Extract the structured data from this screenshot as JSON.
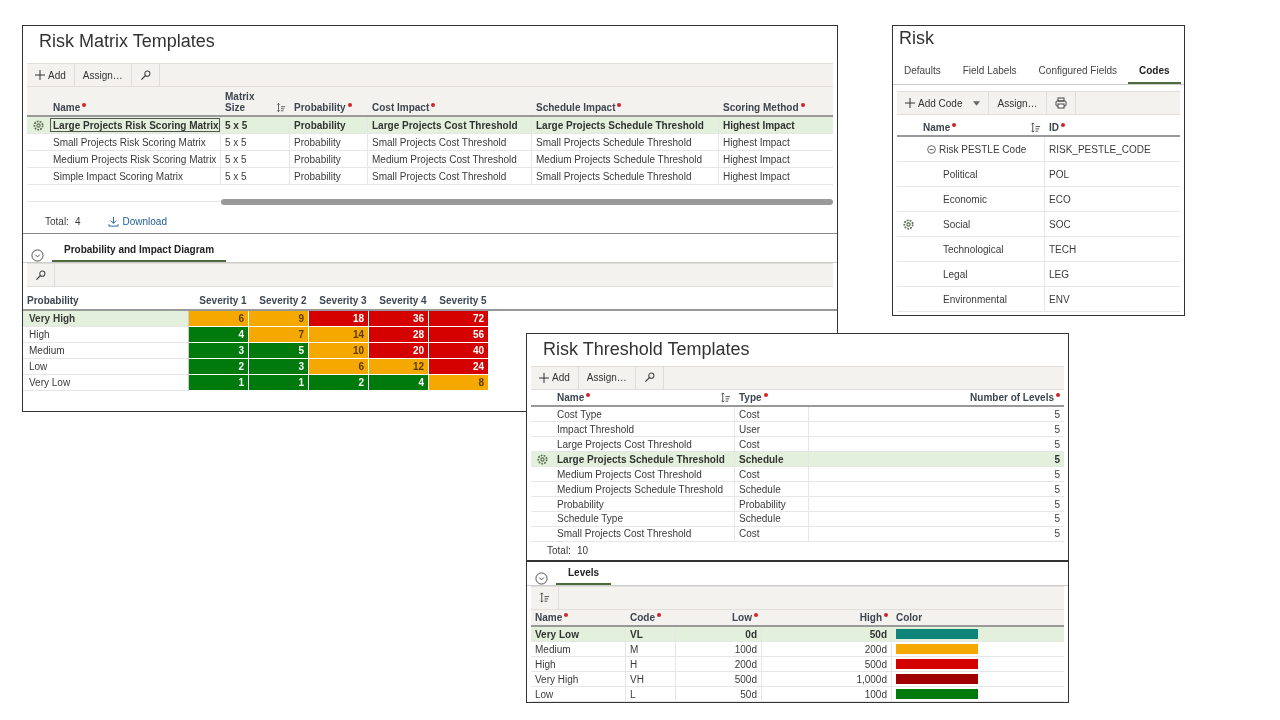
{
  "matrix_templates": {
    "title": "Risk Matrix Templates",
    "toolbar": [
      {
        "kind": "add",
        "label": "Add"
      },
      {
        "kind": "text",
        "label": "Assign…"
      },
      {
        "kind": "tool"
      }
    ],
    "columns": [
      {
        "label": "Name",
        "required": true,
        "sorted": false
      },
      {
        "label": "Matrix Size",
        "required": false,
        "sorted": true
      },
      {
        "label": "Probability",
        "required": true,
        "sorted": false
      },
      {
        "label": "Cost Impact",
        "required": true,
        "sorted": false
      },
      {
        "label": "Schedule Impact",
        "required": true,
        "sorted": false
      },
      {
        "label": "Scoring Method",
        "required": true,
        "sorted": false
      }
    ],
    "rows": [
      {
        "selected": true,
        "cells": [
          "Large Projects Risk Scoring Matrix",
          "5 x 5",
          "Probability",
          "Large Projects Cost Threshold",
          "Large Projects Schedule Threshold",
          "Highest Impact"
        ]
      },
      {
        "selected": false,
        "cells": [
          "Small Projects Risk Scoring Matrix",
          "5 x 5",
          "Probability",
          "Small Projects Cost Threshold",
          "Small Projects Schedule Threshold",
          "Highest Impact"
        ]
      },
      {
        "selected": false,
        "cells": [
          "Medium Projects Risk Scoring Matrix",
          "5 x 5",
          "Probability",
          "Medium Projects Cost Threshold",
          "Medium Projects Schedule Threshold",
          "Highest Impact"
        ]
      },
      {
        "selected": false,
        "cells": [
          "Simple Impact Scoring Matrix",
          "5 x 5",
          "Probability",
          "Small Projects Cost Threshold",
          "Small Projects Schedule Threshold",
          "Highest Impact"
        ]
      }
    ],
    "total_label": "Total:",
    "total": "4",
    "download": "Download",
    "diagram": {
      "tab": "Probability and Impact Diagram",
      "toolbar": [
        {
          "kind": "tool"
        }
      ],
      "row_header_column": "Probability",
      "columns": [
        "Severity 1",
        "Severity 2",
        "Severity 3",
        "Severity 4",
        "Severity 5"
      ],
      "rows": [
        {
          "label": "Very High",
          "selected": true,
          "cells": [
            {
              "value": "6",
              "color": "#f5a800"
            },
            {
              "value": "9",
              "color": "#f5a800"
            },
            {
              "value": "18",
              "color": "#d50000"
            },
            {
              "value": "36",
              "color": "#d50000"
            },
            {
              "value": "72",
              "color": "#d50000"
            }
          ]
        },
        {
          "label": "High",
          "selected": false,
          "cells": [
            {
              "value": "4",
              "color": "#007a0c"
            },
            {
              "value": "7",
              "color": "#f5a800"
            },
            {
              "value": "14",
              "color": "#f5a800"
            },
            {
              "value": "28",
              "color": "#d50000"
            },
            {
              "value": "56",
              "color": "#d50000"
            }
          ]
        },
        {
          "label": "Medium",
          "selected": false,
          "cells": [
            {
              "value": "3",
              "color": "#007a0c"
            },
            {
              "value": "5",
              "color": "#007a0c"
            },
            {
              "value": "10",
              "color": "#f5a800"
            },
            {
              "value": "20",
              "color": "#d50000"
            },
            {
              "value": "40",
              "color": "#d50000"
            }
          ]
        },
        {
          "label": "Low",
          "selected": false,
          "cells": [
            {
              "value": "2",
              "color": "#007a0c"
            },
            {
              "value": "3",
              "color": "#007a0c"
            },
            {
              "value": "6",
              "color": "#f5a800"
            },
            {
              "value": "12",
              "color": "#f5a800"
            },
            {
              "value": "24",
              "color": "#d50000"
            }
          ]
        },
        {
          "label": "Very Low",
          "selected": false,
          "cells": [
            {
              "value": "1",
              "color": "#007a0c"
            },
            {
              "value": "1",
              "color": "#007a0c"
            },
            {
              "value": "2",
              "color": "#007a0c"
            },
            {
              "value": "4",
              "color": "#007a0c"
            },
            {
              "value": "8",
              "color": "#f5a800"
            }
          ]
        }
      ]
    }
  },
  "risk": {
    "title": "Risk",
    "tabs": [
      {
        "label": "Defaults",
        "selected": false
      },
      {
        "label": "Field Labels",
        "selected": false
      },
      {
        "label": "Configured Fields",
        "selected": false
      },
      {
        "label": "Codes",
        "selected": true
      }
    ],
    "toolbar": [
      {
        "kind": "split",
        "label": "Add Code"
      },
      {
        "kind": "text",
        "label": "Assign…"
      },
      {
        "kind": "print"
      }
    ],
    "columns": [
      {
        "label": "Name",
        "required": true,
        "sorted": true
      },
      {
        "label": "ID",
        "required": true,
        "sorted": false
      }
    ],
    "codes": [
      {
        "name": "Risk PESTLE Code",
        "id": "RISK_PESTLE_CODE",
        "expanded": true,
        "selected": false,
        "children": [
          {
            "name": "Political",
            "id": "POL",
            "selected": false
          },
          {
            "name": "Economic",
            "id": "ECO",
            "selected": false
          },
          {
            "name": "Social",
            "id": "SOC",
            "selected": true
          },
          {
            "name": "Technological",
            "id": "TECH",
            "selected": false
          },
          {
            "name": "Legal",
            "id": "LEG",
            "selected": false
          },
          {
            "name": "Environmental",
            "id": "ENV",
            "selected": false
          }
        ]
      }
    ]
  },
  "threshold_templates": {
    "title": "Risk Threshold Templates",
    "toolbar": [
      {
        "kind": "add",
        "label": "Add"
      },
      {
        "kind": "text",
        "label": "Assign…"
      },
      {
        "kind": "tool"
      }
    ],
    "columns": [
      {
        "label": "Name",
        "required": true,
        "sorted": true
      },
      {
        "label": "Type",
        "required": true,
        "sorted": false
      },
      {
        "label": "Number of Levels",
        "required": true,
        "sorted": false
      }
    ],
    "rows": [
      {
        "selected": false,
        "cells": [
          "Cost Type",
          "Cost",
          "5"
        ]
      },
      {
        "selected": false,
        "cells": [
          "Impact Threshold",
          "User",
          "5"
        ]
      },
      {
        "selected": false,
        "cells": [
          "Large Projects Cost Threshold",
          "Cost",
          "5"
        ]
      },
      {
        "selected": true,
        "cells": [
          "Large Projects Schedule Threshold",
          "Schedule",
          "5"
        ]
      },
      {
        "selected": false,
        "cells": [
          "Medium Projects Cost Threshold",
          "Cost",
          "5"
        ]
      },
      {
        "selected": false,
        "cells": [
          "Medium Projects Schedule Threshold",
          "Schedule",
          "5"
        ]
      },
      {
        "selected": false,
        "cells": [
          "Probability",
          "Probability",
          "5"
        ]
      },
      {
        "selected": false,
        "cells": [
          "Schedule Type",
          "Schedule",
          "5"
        ]
      },
      {
        "selected": false,
        "cells": [
          "Small Projects Cost Threshold",
          "Cost",
          "5"
        ]
      }
    ],
    "total_label": "Total:",
    "total": "10",
    "levels": {
      "tab": "Levels",
      "toolbar": [
        {
          "kind": "sort"
        }
      ],
      "columns": [
        {
          "label": "Name",
          "required": true,
          "sorted": false
        },
        {
          "label": "Code",
          "required": true,
          "sorted": false
        },
        {
          "label": "Low",
          "required": true,
          "sorted": false
        },
        {
          "label": "High",
          "required": true,
          "sorted": false
        },
        {
          "label": "Color",
          "required": false,
          "sorted": false
        }
      ],
      "rows": [
        {
          "name": "Very Low",
          "code": "VL",
          "low": "0d",
          "high": "50d",
          "color": "#0f857a",
          "selected": true
        },
        {
          "name": "Medium",
          "code": "M",
          "low": "100d",
          "high": "200d",
          "color": "#f5a800",
          "selected": false
        },
        {
          "name": "High",
          "code": "H",
          "low": "200d",
          "high": "500d",
          "color": "#d50000",
          "selected": false
        },
        {
          "name": "Very High",
          "code": "VH",
          "low": "500d",
          "high": "1,000d",
          "color": "#a00000",
          "selected": false
        },
        {
          "name": "Low",
          "code": "L",
          "low": "50d",
          "high": "100d",
          "color": "#007a0c",
          "selected": false
        }
      ]
    }
  }
}
